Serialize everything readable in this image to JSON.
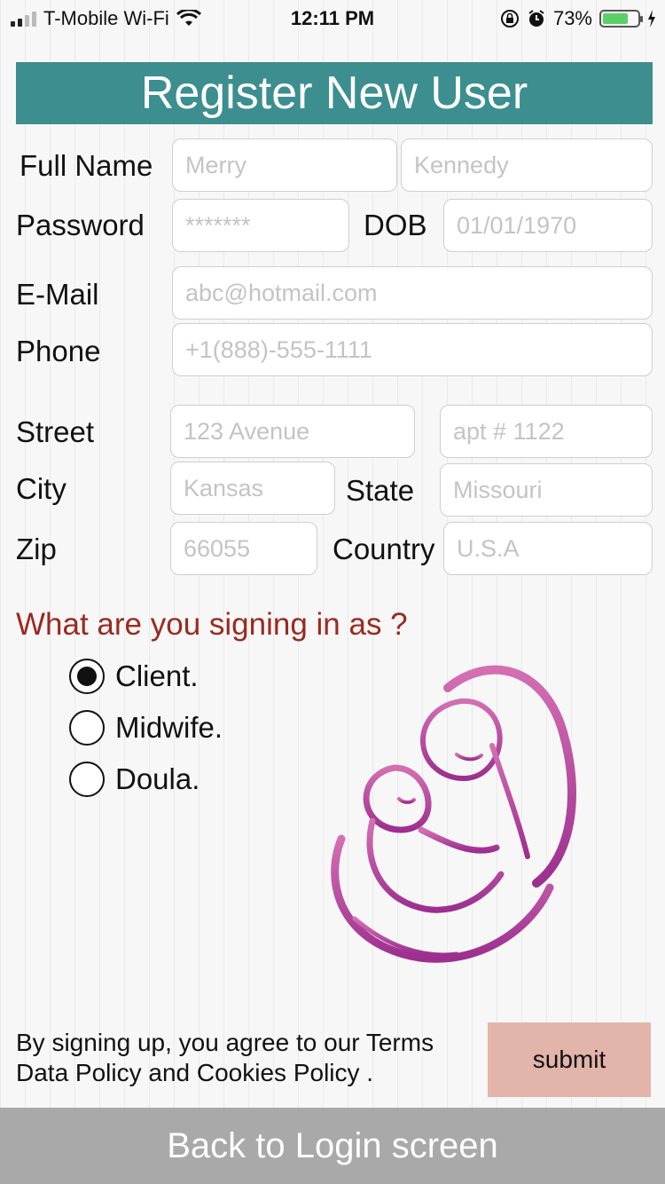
{
  "status_bar": {
    "carrier": "T-Mobile Wi-Fi",
    "time": "12:11 PM",
    "battery": "73%",
    "battery_level": 0.73,
    "icons": [
      "signal-icon",
      "wifi-icon",
      "orientation-lock-icon",
      "alarm-icon",
      "battery-icon",
      "charging-icon"
    ]
  },
  "header": {
    "title": "Register New User",
    "color": "#3c8e8f"
  },
  "form": {
    "full_name_label": "Full Name",
    "first_name_placeholder": "Merry",
    "last_name_placeholder": "Kennedy",
    "password_label": "Password",
    "password_placeholder": "*******",
    "dob_label": "DOB",
    "dob_placeholder": "01/01/1970",
    "email_label": "E-Mail",
    "email_placeholder": "abc@hotmail.com",
    "phone_label": "Phone",
    "phone_placeholder": "+1(888)-555-1111",
    "street_label": "Street",
    "street_placeholder": "123 Avenue",
    "apt_placeholder": "apt # 1122",
    "city_label": "City",
    "city_placeholder": "Kansas",
    "state_label": "State",
    "state_placeholder": "Missouri",
    "zip_label": "Zip",
    "zip_placeholder": "66055",
    "country_label": "Country",
    "country_placeholder": "U.S.A"
  },
  "role": {
    "question": "What are you signing in as ?",
    "question_color": "#9a2a20",
    "options": [
      {
        "label": "Client.",
        "selected": true
      },
      {
        "label": "Midwife.",
        "selected": false
      },
      {
        "label": "Doula.",
        "selected": false
      }
    ]
  },
  "logo": {
    "icon": "mother-child-logo-icon",
    "color": "#b0368f"
  },
  "footer": {
    "terms_line1": "By signing up, you agree to our Terms",
    "terms_line2": "Data Policy and Cookies Policy .",
    "submit_label": "submit",
    "submit_color": "#e2b4aa",
    "back_label": "Back to Login screen",
    "back_color": "#a9a9a9"
  }
}
